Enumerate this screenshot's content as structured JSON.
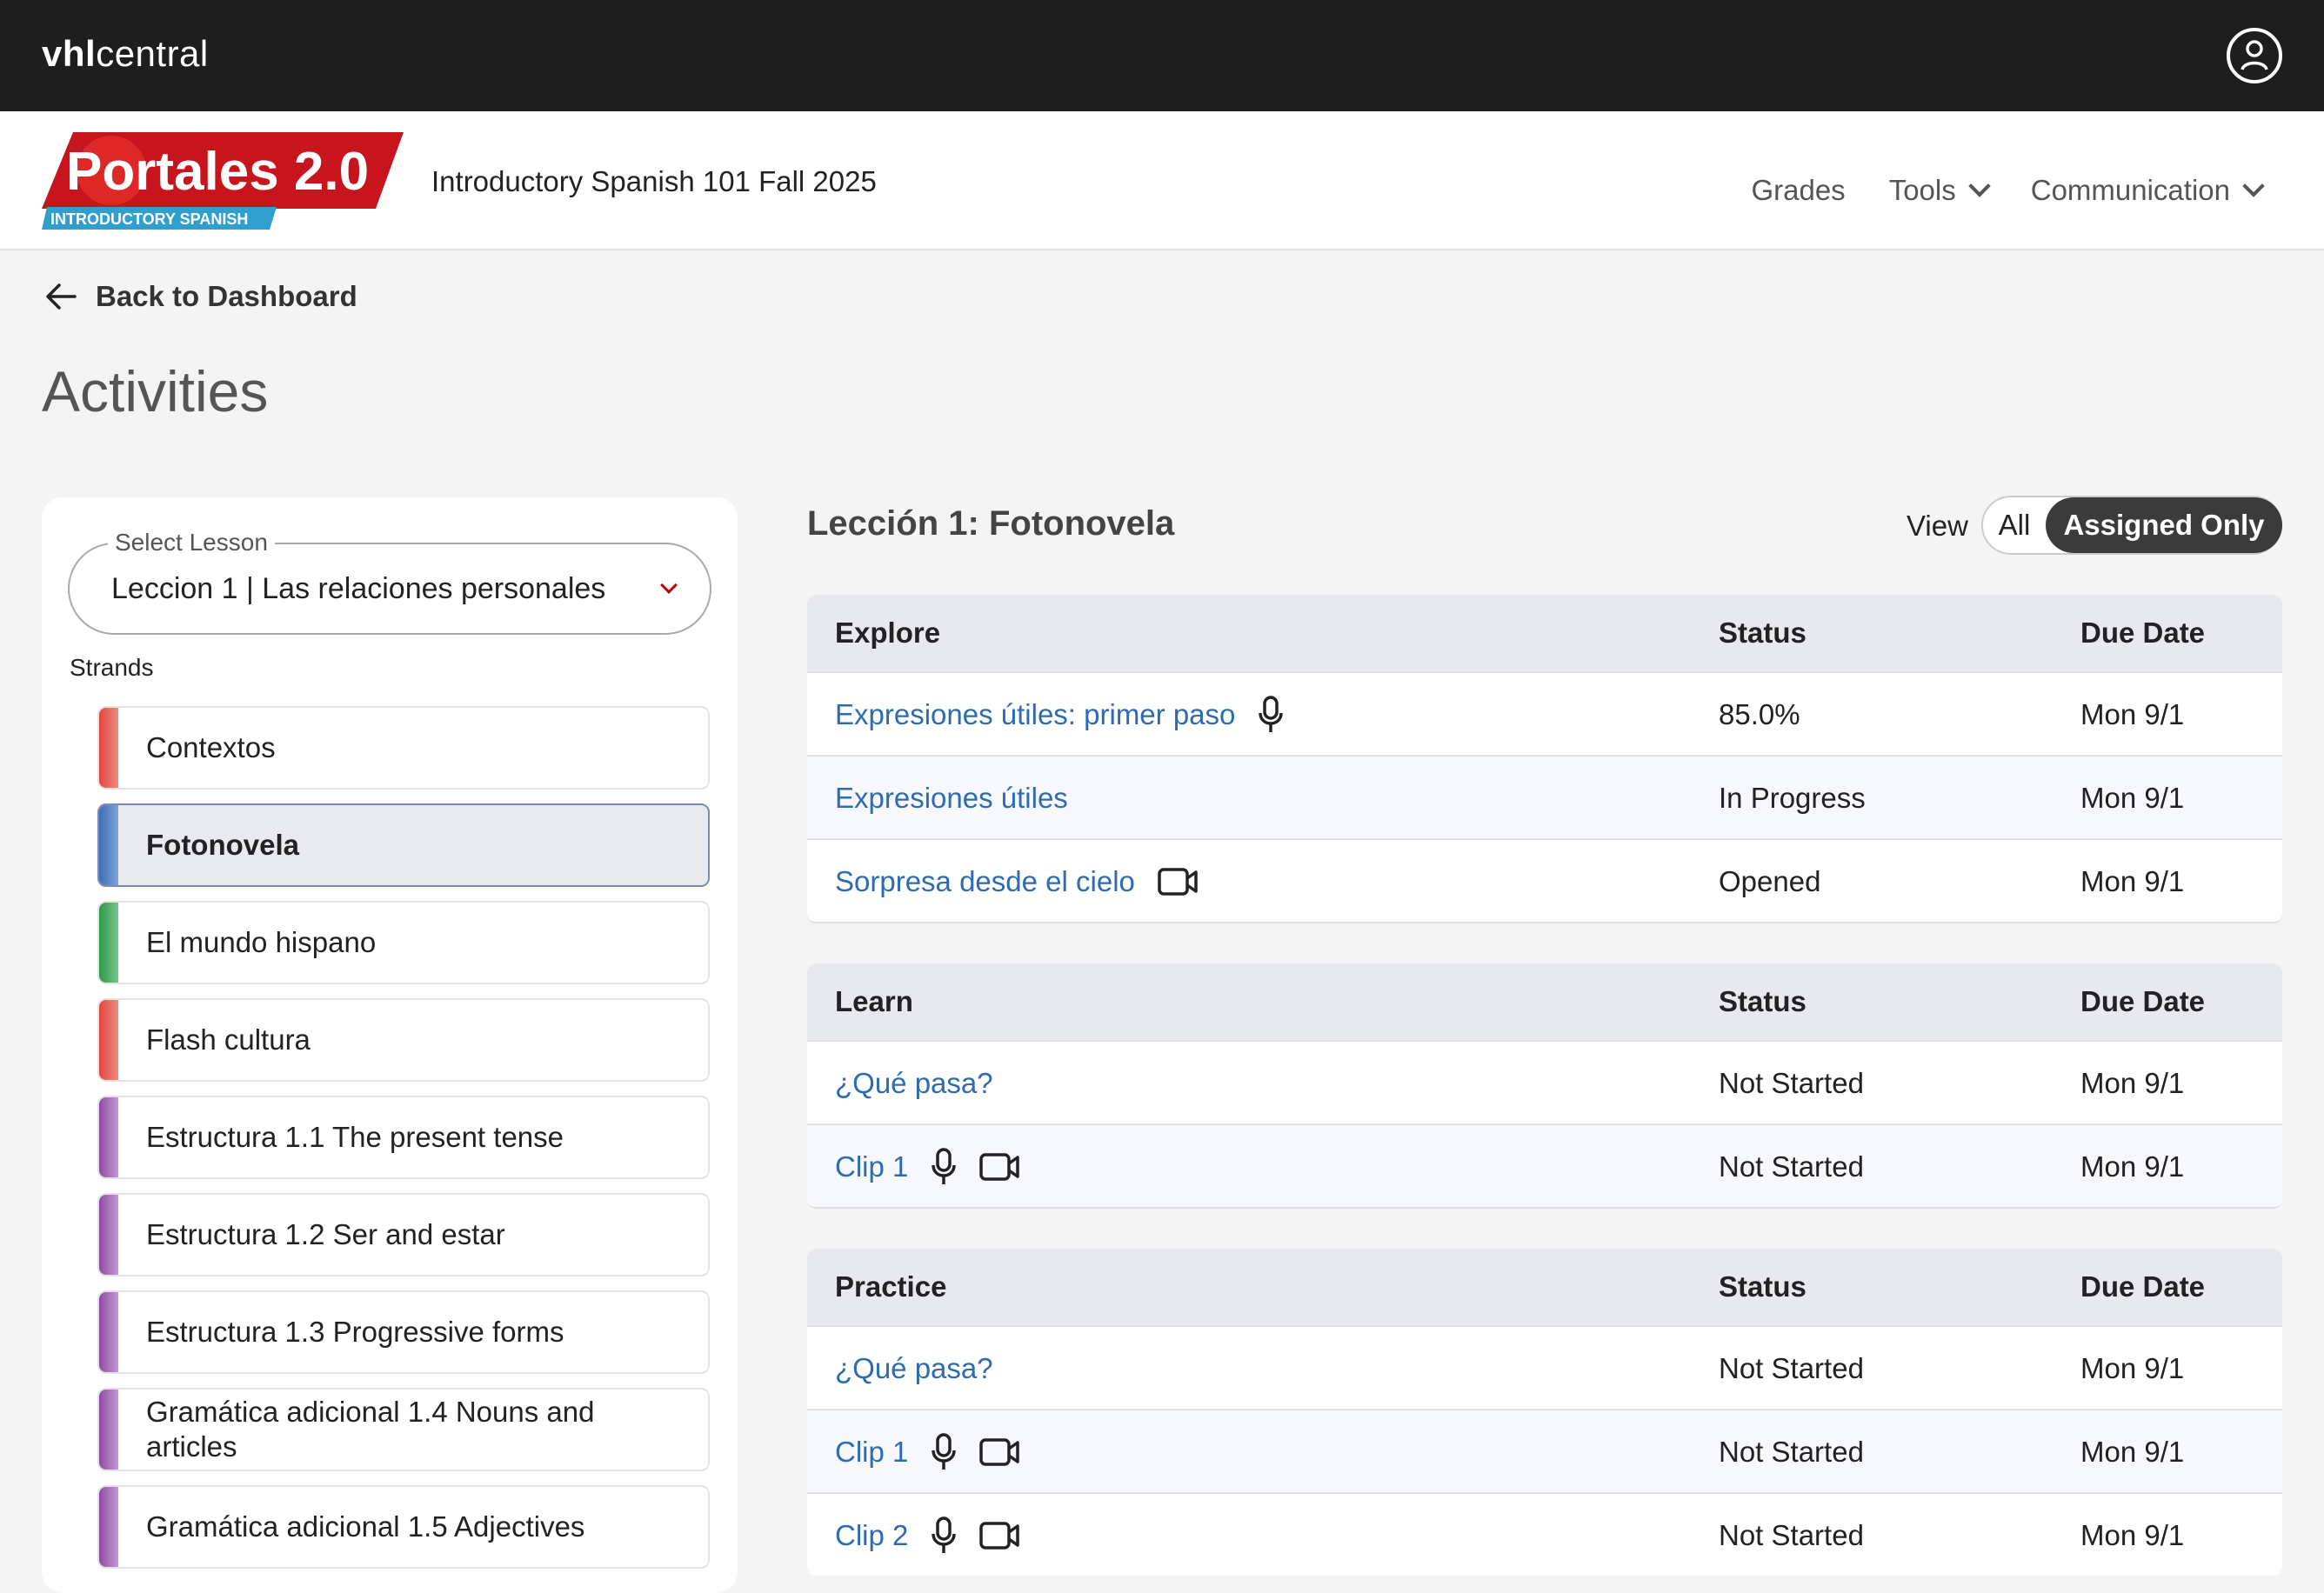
{
  "topbar": {
    "brand_bold": "vhl",
    "brand_light": "central"
  },
  "header": {
    "logo_text": "Portales 2.0",
    "logo_subtext": "INTRODUCTORY SPANISH",
    "course_title": "Introductory Spanish 101 Fall 2025",
    "nav": [
      {
        "label": "Grades"
      },
      {
        "label": "Tools"
      },
      {
        "label": "Communication"
      }
    ]
  },
  "back_label": "Back to Dashboard",
  "page_title": "Activities",
  "lesson_select": {
    "legend": "Select Lesson",
    "value": "Leccion 1 | Las relaciones personales"
  },
  "strands_label": "Strands",
  "strands": [
    {
      "label": "Contextos",
      "color": "#e0463e"
    },
    {
      "label": "Fotonovela",
      "color": "#3b6fb6"
    },
    {
      "label": "El mundo hispano",
      "color": "#2e9a4a"
    },
    {
      "label": "Flash cultura",
      "color": "#e0463e"
    },
    {
      "label": "Estructura 1.1 The present tense",
      "color": "#8e4aa6"
    },
    {
      "label": "Estructura 1.2 Ser and estar",
      "color": "#8e4aa6"
    },
    {
      "label": "Estructura 1.3 Progressive forms",
      "color": "#8e4aa6"
    },
    {
      "label": "Gramática adicional 1.4 Nouns and articles",
      "color": "#8e4aa6"
    },
    {
      "label": "Gramática adicional 1.5 Adjectives",
      "color": "#8e4aa6"
    }
  ],
  "lesson_heading": "Lección 1: Fotonovela",
  "view": {
    "label": "View",
    "all": "All",
    "assigned": "Assigned Only"
  },
  "sections": [
    {
      "title": "Explore",
      "status_header": "Status",
      "due_header": "Due Date",
      "rows": [
        {
          "name": "Expresiones útiles: primer paso",
          "status": "85.0%",
          "due": "Mon 9/1"
        },
        {
          "name": "Expresiones útiles",
          "status": "In Progress",
          "due": "Mon 9/1"
        },
        {
          "name": "Sorpresa desde el cielo",
          "status": "Opened",
          "due": "Mon 9/1"
        }
      ]
    },
    {
      "title": "Learn",
      "status_header": "Status",
      "due_header": "Due Date",
      "rows": [
        {
          "name": "¿Qué pasa?",
          "status": "Not Started",
          "due": "Mon 9/1"
        },
        {
          "name": "Clip 1",
          "status": "Not Started",
          "due": "Mon 9/1"
        }
      ]
    },
    {
      "title": "Practice",
      "status_header": "Status",
      "due_header": "Due Date",
      "rows": [
        {
          "name": "¿Qué pasa?",
          "status": "Not Started",
          "due": "Mon 9/1"
        },
        {
          "name": "Clip 1",
          "status": "Not Started",
          "due": "Mon 9/1"
        },
        {
          "name": "Clip 2",
          "status": "Not Started",
          "due": "Mon 9/1"
        }
      ]
    }
  ]
}
